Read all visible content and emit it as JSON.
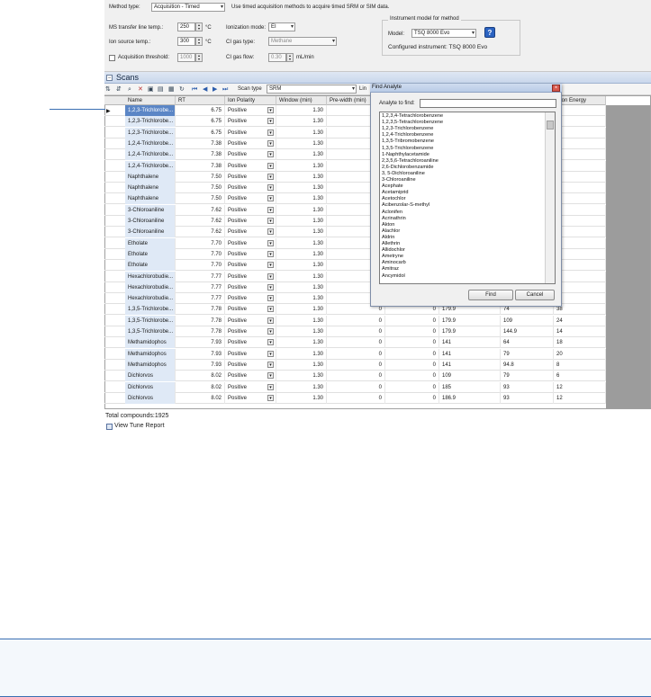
{
  "method": {
    "method_type_label": "Method type:",
    "method_type_value": "Acquisition - Timed",
    "method_type_hint": "Use timed acquisition methods to acquire timed SRM or SIM data.",
    "ms_transfer_label": "MS transfer line temp.:",
    "ms_transfer_value": "250",
    "ms_transfer_unit": "°C",
    "ion_source_label": "Ion source temp.:",
    "ion_source_value": "300",
    "ion_source_unit": "°C",
    "acq_threshold_label": "Acquisition threshold:",
    "acq_threshold_value": "1000",
    "ionization_label": "Ionization mode:",
    "ionization_value": "EI",
    "ci_gas_type_label": "CI gas type:",
    "ci_gas_type_value": "Methane",
    "ci_gas_flow_label": "CI gas flow:",
    "ci_gas_flow_value": "0.30",
    "ci_gas_flow_unit": "mL/min",
    "instrument_group_title": "Instrument model for method",
    "model_label": "Model:",
    "model_value": "TSQ 8000 Evo",
    "configured_text": "Configured instrument: TSQ 8000 Evo",
    "help_icon": "?"
  },
  "scans": {
    "title": "Scans",
    "scan_type_label": "Scan type",
    "scan_type_value": "SRM",
    "lin_label": "Lin",
    "collapse_glyph": "−"
  },
  "toolbar_icons": [
    "sort-az-icon",
    "sort-za-icon",
    "find-icon",
    "delete-icon",
    "import-icon",
    "export-icon",
    "grid-icon",
    "refresh-icon",
    "first-icon",
    "prev-icon",
    "next-icon",
    "last-icon"
  ],
  "table": {
    "columns": [
      "Name",
      "RT",
      "Ion Polarity",
      "Window (min)",
      "Pre-width (min)",
      "",
      "",
      "",
      "ision Energy"
    ],
    "rows": [
      [
        "1,2,3-Trichlorobe...",
        "6.75",
        "Positive",
        "1.30",
        "",
        "",
        "",
        "",
        ""
      ],
      [
        "1,2,3-Trichlorobe...",
        "6.75",
        "Positive",
        "1.30",
        "",
        "",
        "",
        "",
        ""
      ],
      [
        "1,2,3-Trichlorobe...",
        "6.75",
        "Positive",
        "1.30",
        "",
        "",
        "",
        "",
        ""
      ],
      [
        "1,2,4-Trichlorobe...",
        "7.38",
        "Positive",
        "1.30",
        "",
        "",
        "",
        "",
        ""
      ],
      [
        "1,2,4-Trichlorobe...",
        "7.38",
        "Positive",
        "1.30",
        "",
        "",
        "",
        "",
        ""
      ],
      [
        "1,2,4-Trichlorobe...",
        "7.38",
        "Positive",
        "1.30",
        "",
        "",
        "",
        "",
        ""
      ],
      [
        "Naphthalene",
        "7.50",
        "Positive",
        "1.30",
        "",
        "",
        "",
        "",
        ""
      ],
      [
        "Naphthalene",
        "7.50",
        "Positive",
        "1.30",
        "",
        "",
        "",
        "",
        ""
      ],
      [
        "Naphthalene",
        "7.50",
        "Positive",
        "1.30",
        "",
        "",
        "",
        "",
        ""
      ],
      [
        "3-Chloroaniline",
        "7.62",
        "Positive",
        "1.30",
        "",
        "",
        "",
        "",
        ""
      ],
      [
        "3-Chloroaniline",
        "7.62",
        "Positive",
        "1.30",
        "",
        "",
        "",
        "",
        ""
      ],
      [
        "3-Chloroaniline",
        "7.62",
        "Positive",
        "1.30",
        "",
        "",
        "",
        "",
        ""
      ],
      [
        "Etholate",
        "7.70",
        "Positive",
        "1.30",
        "",
        "",
        "",
        "",
        ""
      ],
      [
        "Etholate",
        "7.70",
        "Positive",
        "1.30",
        "",
        "",
        "",
        "",
        ""
      ],
      [
        "Etholate",
        "7.70",
        "Positive",
        "1.30",
        "",
        "",
        "",
        "",
        ""
      ],
      [
        "Hexachlorobudie...",
        "7.77",
        "Positive",
        "1.30",
        "",
        "",
        "",
        "",
        ""
      ],
      [
        "Hexachlorobudie...",
        "7.77",
        "Positive",
        "1.30",
        "",
        "",
        "",
        "",
        ""
      ],
      [
        "Hexachlorobudie...",
        "7.77",
        "Positive",
        "1.30",
        "",
        "",
        "",
        "",
        ""
      ],
      [
        "1,3,5-Trichlorobe...",
        "7.78",
        "Positive",
        "1.30",
        "0",
        "0",
        "179.9",
        "74",
        "38"
      ],
      [
        "1,3,5-Trichlorobe...",
        "7.78",
        "Positive",
        "1.30",
        "0",
        "0",
        "179.9",
        "109",
        "24"
      ],
      [
        "1,3,5-Trichlorobe...",
        "7.78",
        "Positive",
        "1.30",
        "0",
        "0",
        "179.9",
        "144.9",
        "14"
      ],
      [
        "Methamidophos",
        "7.93",
        "Positive",
        "1.30",
        "0",
        "0",
        "141",
        "64",
        "18"
      ],
      [
        "Methamidophos",
        "7.93",
        "Positive",
        "1.30",
        "0",
        "0",
        "141",
        "79",
        "20"
      ],
      [
        "Methamidophos",
        "7.93",
        "Positive",
        "1.30",
        "0",
        "0",
        "141",
        "94.8",
        "8"
      ],
      [
        "Dichlorvos",
        "8.02",
        "Positive",
        "1.30",
        "0",
        "0",
        "109",
        "79",
        "6"
      ],
      [
        "Dichlorvos",
        "8.02",
        "Positive",
        "1.30",
        "0",
        "0",
        "185",
        "93",
        "12"
      ],
      [
        "Dichlorvos",
        "8.02",
        "Positive",
        "1.30",
        "0",
        "0",
        "186.9",
        "93",
        "12"
      ]
    ]
  },
  "dialog": {
    "title": "Find Analyte",
    "close_glyph": "×",
    "find_label": "Analyte to find:",
    "find_value": "",
    "items": [
      "1,2,3,4-Tetrachlorobenzene",
      "1,2,3,5-Tetrachlorobenzene",
      "1,2,3-Trichlorobenzene",
      "1,2,4-Trichlorobenzene",
      "1,3,5-Tribromobenzene",
      "1,3,5-Trichlorobenzene",
      "1-Naphthylacetamide",
      "2,3,5,6-Tetrachloroaniline",
      "2,6-Dichlorobenzamide",
      "3, 5-Dichloroaniline",
      "3-Chloroaniline",
      "Acephate",
      "Acetamiprid",
      "Acetochlor",
      "Acibenzolar-S-methyl",
      "Aclonifen",
      "Acrinathrin",
      "Akton",
      "Alachlor",
      "Aldrin",
      "Allethrin",
      "Allidochlor",
      "Ametryne",
      "Aminocarb",
      "Amitraz",
      "Ancymidol"
    ],
    "find_button": "Find",
    "cancel_button": "Cancel"
  },
  "footer": {
    "total_compounds": "Total compounds:1925",
    "view_tune_report": "View Tune Report"
  },
  "colors": {
    "accent": "#3a6fb3",
    "selected_row": "#5b86c6",
    "name_cell": "#dfe9f6"
  }
}
